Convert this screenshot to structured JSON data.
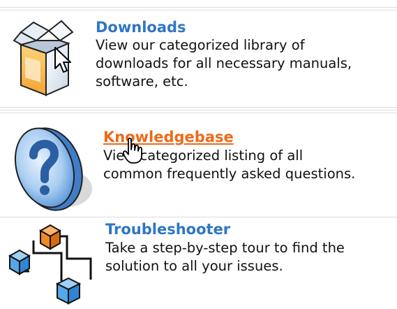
{
  "items": [
    {
      "title": "Downloads",
      "description": [
        "View our categorized library of",
        "downloads for all necessary manuals,",
        "software, etc."
      ],
      "icon": "box-icon",
      "state": "normal"
    },
    {
      "title": "Knowledgebase",
      "description": [
        "View categorized listing of all",
        "common frequently asked questions."
      ],
      "icon": "question-icon",
      "state": "hover"
    },
    {
      "title": "Troubleshooter",
      "description": [
        "Take a step-by-step tour to find the",
        "solution to all your issues."
      ],
      "icon": "cubes-icon",
      "state": "normal"
    }
  ],
  "colors": {
    "link": "#2f76c4",
    "link_hover": "#ec6a1a",
    "text": "#111111",
    "divider": "#dcdcdc"
  }
}
